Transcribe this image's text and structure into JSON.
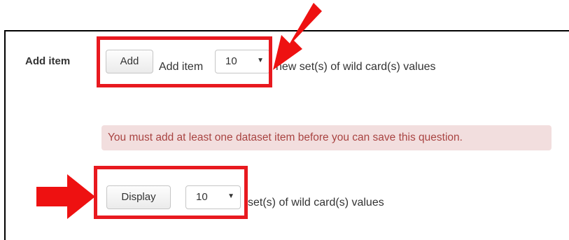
{
  "add_row": {
    "label": "Add item",
    "add_button": "Add",
    "add_item_text": "Add item",
    "select_value": "10",
    "suffix_text": "new set(s) of wild card(s) values"
  },
  "alert": {
    "message": "You must add at least one dataset item before you can save this question."
  },
  "display_row": {
    "display_button": "Display",
    "select_value": "10",
    "suffix_text": "set(s) of wild card(s) values"
  },
  "annotations": {
    "highlight_color": "#e8191f",
    "arrow_color": "#ee1111"
  },
  "icons": {
    "caret": "caret-down-icon",
    "arrow_diagonal": "arrow-down-left-icon",
    "arrow_right": "arrow-right-icon"
  },
  "colors": {
    "alert_bg": "#f2dede",
    "alert_text": "#a94442",
    "button_border": "#c6c6c6",
    "panel_border": "#000000"
  }
}
